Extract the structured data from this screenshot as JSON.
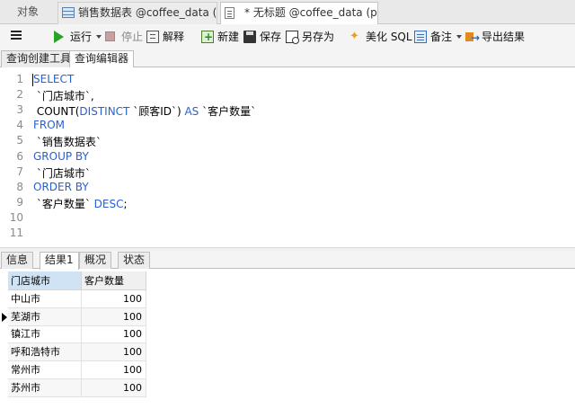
{
  "tabs": {
    "objects": "对象",
    "sales": "销售数据表 @coffee_data (p...",
    "query": "* 无标题 @coffee_data (pac..."
  },
  "toolbar": {
    "run": "运行",
    "stop": "停止",
    "explain": "解释",
    "new": "新建",
    "save": "保存",
    "save_as": "另存为",
    "beautify": "美化 SQL",
    "note": "备注",
    "export": "导出结果"
  },
  "subtabs": [
    "查询创建工具",
    "查询编辑器"
  ],
  "editor": {
    "line_numbers": [
      "1",
      "2",
      "3",
      "4",
      "5",
      "6",
      "7",
      "8",
      "9",
      "10",
      "11"
    ],
    "lines": [
      [
        {
          "t": "SELECT",
          "k": 1
        }
      ],
      [
        {
          "t": " `门店城市`,",
          "k": 0
        }
      ],
      [
        {
          "t": " COUNT(",
          "k": 0
        },
        {
          "t": "DISTINCT",
          "k": 1
        },
        {
          "t": " `顾客ID`) ",
          "k": 0
        },
        {
          "t": "AS",
          "k": 1
        },
        {
          "t": " `客户数量`",
          "k": 0
        }
      ],
      [
        {
          "t": "FROM",
          "k": 1
        }
      ],
      [
        {
          "t": " `销售数据表`",
          "k": 0
        }
      ],
      [
        {
          "t": "GROUP BY",
          "k": 1
        }
      ],
      [
        {
          "t": " `门店城市`",
          "k": 0
        }
      ],
      [
        {
          "t": "ORDER BY",
          "k": 1
        }
      ],
      [
        {
          "t": " `客户数量` ",
          "k": 0
        },
        {
          "t": "DESC",
          "k": 1
        },
        {
          "t": ";",
          "k": 0
        }
      ],
      [],
      []
    ]
  },
  "result_tabs": [
    "信息",
    "结果1",
    "概况",
    "状态"
  ],
  "grid": {
    "columns": [
      "门店城市",
      "客户数量"
    ],
    "rows": [
      [
        "中山市",
        "100"
      ],
      [
        "芜湖市",
        "100"
      ],
      [
        "镇江市",
        "100"
      ],
      [
        "呼和浩特市",
        "100"
      ],
      [
        "常州市",
        "100"
      ],
      [
        "苏州市",
        "100"
      ]
    ],
    "current_row": 1
  },
  "colors": {
    "keyword": "#2a5fd0",
    "selected_header": "#cfe3f5"
  }
}
